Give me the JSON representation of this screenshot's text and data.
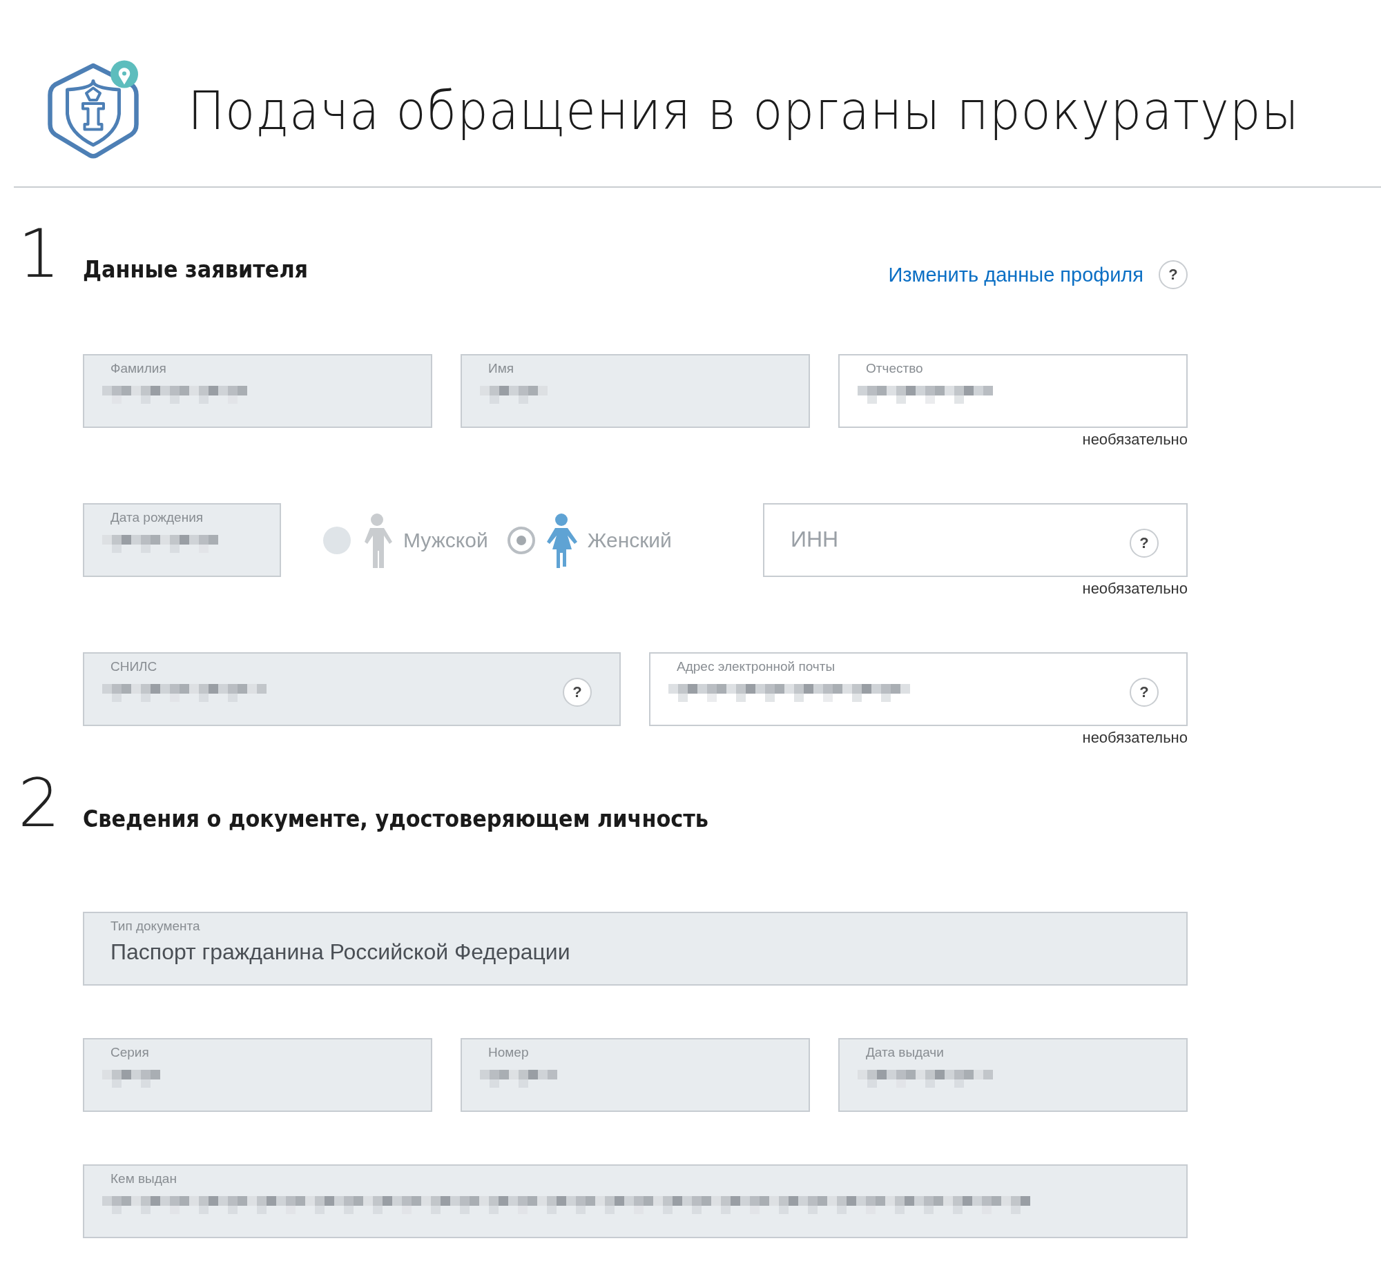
{
  "header": {
    "title": "Подача обращения в органы прокуратуры"
  },
  "sections": [
    {
      "number": "1",
      "title": "Данные заявителя",
      "link": "Изменить данные профиля",
      "help": "?",
      "lines": [
        {
          "items": [
            {
              "kind": "field",
              "label": "Фамилия",
              "filled": true,
              "readonly": true
            },
            {
              "kind": "field",
              "label": "Имя",
              "filled": true,
              "readonly": true
            },
            {
              "kind": "field",
              "label": "Отчество",
              "filled": true,
              "readonly": false,
              "note": "необязательно"
            }
          ]
        },
        {
          "items": [
            {
              "kind": "field",
              "label": "Дата рождения",
              "filled": true,
              "readonly": true
            },
            {
              "kind": "gender",
              "options": [
                {
                  "label": "Мужской",
                  "selected": false
                },
                {
                  "label": "Женский",
                  "selected": true
                }
              ]
            },
            {
              "kind": "field",
              "placeholder": "ИНН",
              "filled": false,
              "readonly": false,
              "help": "?",
              "note": "необязательно"
            }
          ]
        },
        {
          "items": [
            {
              "kind": "field",
              "label": "СНИЛС",
              "filled": true,
              "readonly": true,
              "help": "?"
            },
            {
              "kind": "field",
              "label": "Адрес электронной почты",
              "filled": true,
              "readonly": false,
              "help": "?",
              "note": "необязательно"
            }
          ]
        }
      ]
    },
    {
      "number": "2",
      "title": "Сведения о документе, удостоверяющем личность",
      "lines": [
        {
          "items": [
            {
              "kind": "field",
              "label": "Тип документа",
              "value": "Паспорт гражданина Российской Федерации",
              "filled": false,
              "readonly": true
            }
          ]
        },
        {
          "items": [
            {
              "kind": "field",
              "label": "Серия",
              "filled": true,
              "readonly": true
            },
            {
              "kind": "field",
              "label": "Номер",
              "filled": true,
              "readonly": true
            },
            {
              "kind": "field",
              "label": "Дата выдачи",
              "filled": true,
              "readonly": true
            }
          ]
        },
        {
          "items": [
            {
              "kind": "field",
              "label": "Кем выдан",
              "filled": true,
              "readonly": true
            }
          ]
        }
      ]
    }
  ]
}
